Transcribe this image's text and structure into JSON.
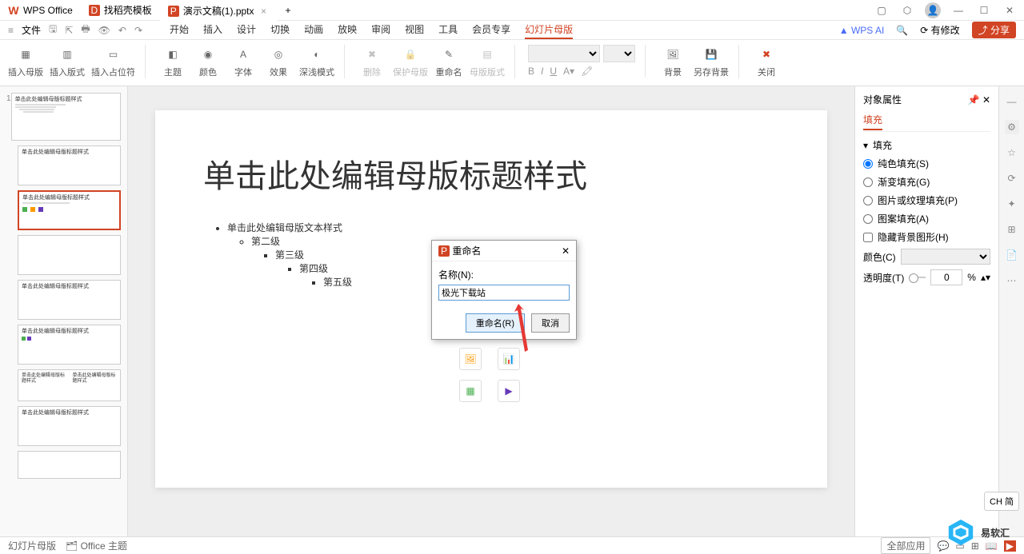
{
  "titlebar": {
    "app_name": "WPS Office",
    "tabs": [
      {
        "icon": "D",
        "label": "找稻壳模板",
        "icon_color": "#d14424"
      },
      {
        "icon": "P",
        "label": "演示文稿(1).pptx",
        "icon_color": "#d14424",
        "active": true
      }
    ]
  },
  "menubar": {
    "file": "文件",
    "tabs": [
      "开始",
      "插入",
      "设计",
      "切换",
      "动画",
      "放映",
      "审阅",
      "视图",
      "工具",
      "会员专享",
      "幻灯片母版"
    ],
    "active_tab": "幻灯片母版",
    "ai": "WPS AI",
    "modified": "有修改",
    "share": "分享"
  },
  "toolbar": {
    "insert_master": "插入母版",
    "insert_layout": "插入版式",
    "insert_placeholder": "插入占位符",
    "theme": "主题",
    "color": "颜色",
    "font": "字体",
    "effect": "效果",
    "pattern": "深浅模式",
    "delete": "删除",
    "protect_master": "保护母版",
    "rename": "重命名",
    "master_layout": "母版版式",
    "background": "背景",
    "save_bg": "另存背景",
    "close": "关闭"
  },
  "slide": {
    "title": "单击此处编辑母版标题样式",
    "lvl1": "单击此处编辑母版文本样式",
    "lvl2": "第二级",
    "lvl3": "第三级",
    "lvl4": "第四级",
    "lvl5": "第五级"
  },
  "thumb_text": "单击此处编辑母版标题样式",
  "dialog": {
    "title": "重命名",
    "name_label": "名称(N):",
    "value": "极光下载站",
    "confirm": "重命名(R)",
    "cancel": "取消"
  },
  "panel": {
    "title": "对象属性",
    "tab": "填充",
    "section": "填充",
    "solid": "纯色填充(S)",
    "gradient": "渐变填充(G)",
    "picture": "图片或纹理填充(P)",
    "pattern": "图案填充(A)",
    "hide_bg": "隐藏背景图形(H)",
    "color": "颜色(C)",
    "transparency": "透明度(T)",
    "trans_value": "0",
    "trans_unit": "%"
  },
  "statusbar": {
    "master_view": "幻灯片母版",
    "theme": "Office 主题",
    "all_apps": "全部应用"
  },
  "lang": "CH 简",
  "watermark": "易软汇"
}
